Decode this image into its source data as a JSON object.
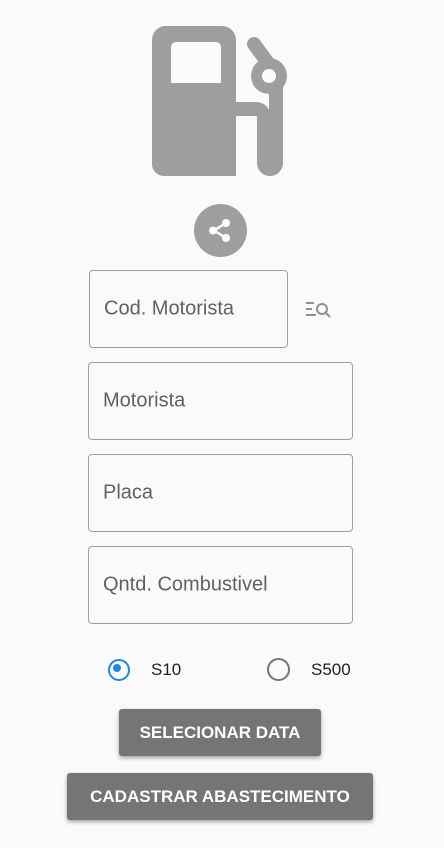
{
  "colors": {
    "icon": "#9e9e9e",
    "button": "#757575",
    "accent": "#1e88e5",
    "background": "#fafafa"
  },
  "header": {
    "logo_icon": "fuel-pump-icon",
    "share_icon": "share-icon"
  },
  "form": {
    "cod_motorista": {
      "placeholder": "Cod. Motorista",
      "search_icon": "list-search-icon"
    },
    "motorista": {
      "placeholder": "Motorista"
    },
    "placa": {
      "placeholder": "Placa"
    },
    "quantidade": {
      "placeholder": "Qntd. Combustivel"
    },
    "fuel_type": {
      "options": [
        {
          "label": "S10",
          "selected": true
        },
        {
          "label": "S500",
          "selected": false
        }
      ]
    }
  },
  "actions": {
    "select_date": "SELECIONAR DATA",
    "submit": "CADASTRAR ABASTECIMENTO"
  }
}
